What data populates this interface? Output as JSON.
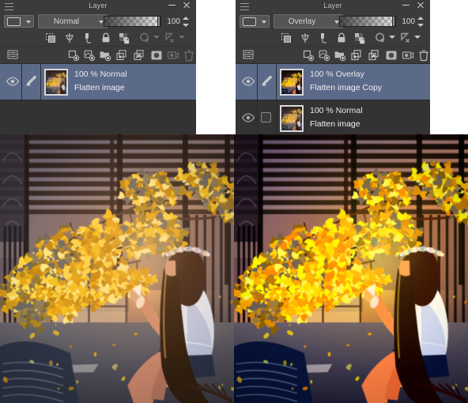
{
  "app": {
    "palette_title": "Layer",
    "menu_icon": "hamburger-icon",
    "minimize_icon": "minimize-icon",
    "close_icon": "close-icon"
  },
  "panels": [
    {
      "id": "before",
      "title": "Layer",
      "blend_mode": "Normal",
      "opacity": "100",
      "opacity_percent": 100,
      "color_swatch": "#4a4a4a",
      "toolbar_property_icons": [
        "clipping-mask-icon",
        "mask-to-layer-icon",
        "layer-color-icon",
        "lock-layer-icon",
        "lock-transparent-pixels-icon",
        "select-layer-icon",
        "ruler-snap-icon",
        "draw-color-swatch-icon"
      ],
      "toolbar_action_icons": [
        "layer-list-settings-icon",
        "new-raster-layer-icon",
        "new-vector-layer-icon",
        "new-folder-icon",
        "move-layer-down-icon",
        "duplicate-layer-icon",
        "create-mask-icon",
        "merge-down-icon",
        "delete-layer-icon"
      ],
      "layers": [
        {
          "visible": true,
          "selected": true,
          "has_edit_pencil": true,
          "info": "100 % Normal",
          "name": "Flatten image"
        }
      ]
    },
    {
      "id": "after",
      "title": "Layer",
      "blend_mode": "Overlay",
      "opacity": "100",
      "opacity_percent": 100,
      "color_swatch": "#4a4a4a",
      "toolbar_property_icons": [
        "clipping-mask-icon",
        "mask-to-layer-icon",
        "layer-color-icon",
        "lock-layer-icon",
        "lock-transparent-pixels-icon",
        "select-layer-icon",
        "ruler-snap-icon",
        "draw-color-swatch-icon"
      ],
      "toolbar_action_icons": [
        "layer-list-settings-icon",
        "new-raster-layer-icon",
        "new-vector-layer-icon",
        "new-folder-icon",
        "move-layer-down-icon",
        "duplicate-layer-icon",
        "create-mask-icon",
        "merge-down-icon",
        "delete-layer-icon"
      ],
      "layers": [
        {
          "visible": true,
          "selected": true,
          "has_edit_pencil": true,
          "info": "100 % Overlay",
          "name": "Flatten image Copy"
        },
        {
          "visible": true,
          "selected": false,
          "has_edit_pencil": false,
          "info": "100 % Normal",
          "name": "Flatten image"
        }
      ]
    }
  ],
  "artworks": [
    {
      "id": "artwork-before",
      "alt": "Illustration of a girl sitting under a golden ginkgo tree beside a fence at sunset",
      "contrast": 1.0,
      "saturation": 1.0,
      "brightness": 1.0
    },
    {
      "id": "artwork-after",
      "alt": "Same illustration with an Overlay blend layer increasing contrast and saturation",
      "contrast": 1.45,
      "saturation": 1.5,
      "brightness": 1.0
    }
  ],
  "theme": {
    "panel_bg": "#3b3b3b",
    "list_bg": "#333333",
    "selection_blue": "#5c6a8a",
    "accent_blue": "#4a79c4",
    "text": "#e8e8e8",
    "text_dim": "#b9b9b9",
    "icon": "#b4b4b4",
    "icon_disabled": "#6e6e6e",
    "page_bg": "#ffffff"
  }
}
